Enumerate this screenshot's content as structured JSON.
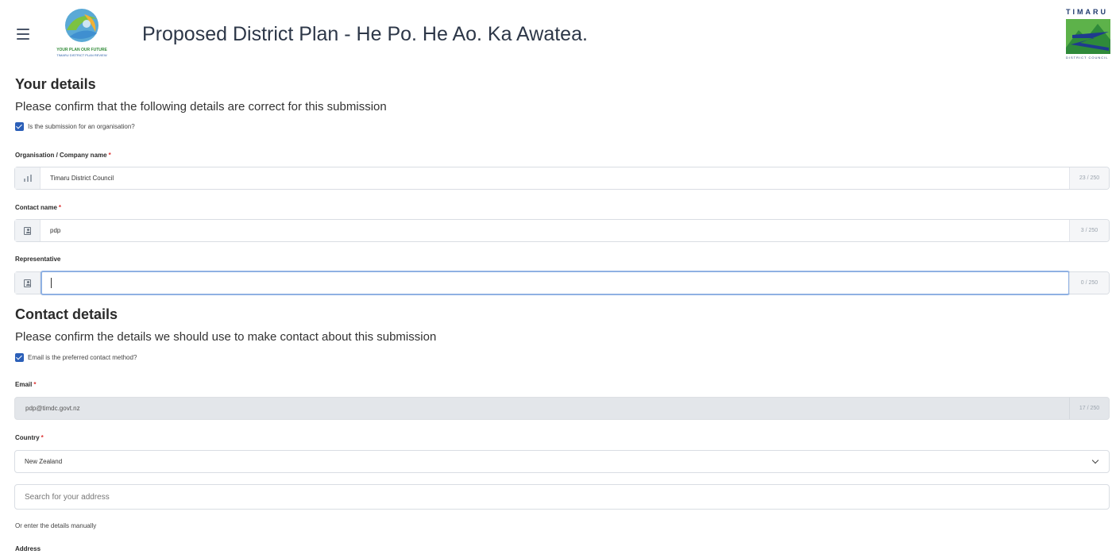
{
  "header": {
    "menu_icon": "hamburger-menu-icon",
    "title": "Proposed District Plan - He Po. He Ao. Ka Awatea.",
    "left_logo_alt": "Your Plan Our Future logo",
    "left_logo_caption": "YOUR PLAN OUR FUTURE",
    "left_logo_subcaption": "TIMARU DISTRICT PLAN REVIEW",
    "right_logo_text": "TIMARU",
    "right_logo_subtext": "DISTRICT COUNCIL"
  },
  "your_details": {
    "title": "Your details",
    "description": "Please confirm that the following details are correct for this submission",
    "organisation_checkbox": {
      "label": "Is the submission for an organisation?",
      "checked": true
    },
    "organisation": {
      "label": "Organisation / Company name",
      "required_mark": "*",
      "value": "Timaru District Council",
      "counter": "23 / 250",
      "icon": "building-icon"
    },
    "contact": {
      "label": "Contact name",
      "required_mark": "*",
      "value": "pdp",
      "counter": "3 / 250",
      "icon": "person-card-icon"
    },
    "representative": {
      "label": "Representative",
      "value": "",
      "counter": "0 / 250",
      "icon": "person-card-icon"
    }
  },
  "contact_details": {
    "title": "Contact details",
    "description": "Please confirm the details we should use to make contact about this submission",
    "email_checkbox": {
      "label": "Email is the preferred contact method?",
      "checked": true
    },
    "email": {
      "label": "Email",
      "required_mark": "*",
      "value": "pdp@timdc.govt.nz",
      "counter": "17 / 250"
    },
    "country": {
      "label": "Country",
      "required_mark": "*",
      "selected": "New Zealand",
      "icon": "chevron-down-icon"
    },
    "address_search": {
      "placeholder": "Search for your address"
    },
    "manual_link": "Or enter the details manually",
    "address_label": "Address"
  },
  "colors": {
    "checkbox": "#2b5fb8",
    "focus_ring": "#8fb1e3",
    "required": "#dd3333",
    "disabled_bg": "#e3e6ea"
  }
}
